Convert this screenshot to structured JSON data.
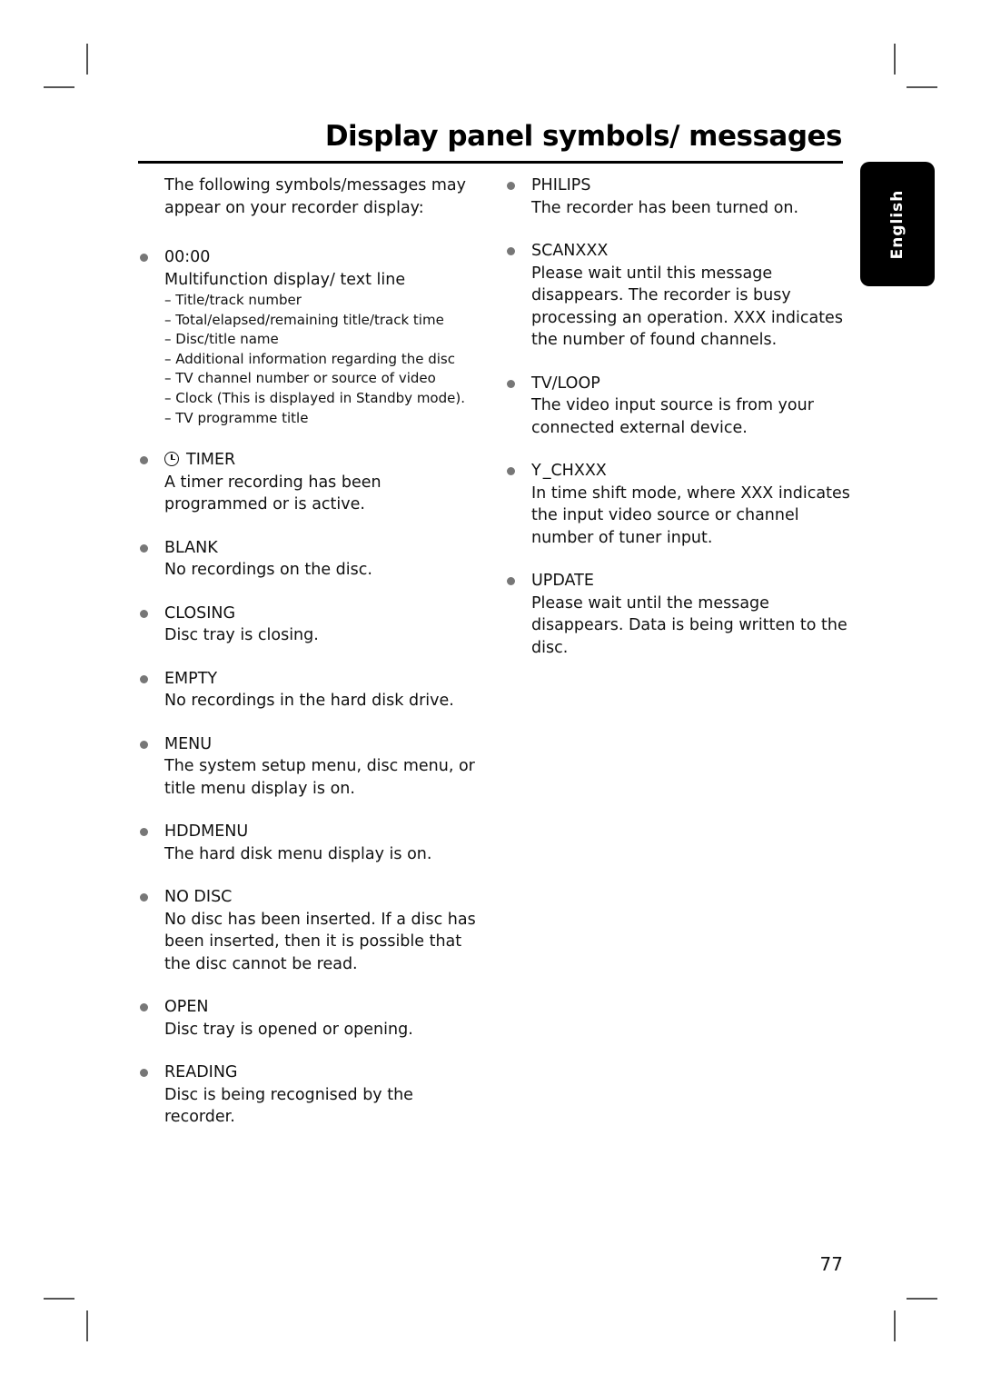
{
  "page": {
    "title": "Display panel symbols/ messages",
    "language_tab": "English",
    "page_number": "77"
  },
  "intro": "The following symbols/messages may appear on your recorder display:",
  "left_items": [
    {
      "head": "00:00",
      "desc": "Multifunction display/ text line",
      "sub": [
        "– Title/track number",
        "– Total/elapsed/remaining title/track time",
        "– Disc/title name",
        "– Additional information regarding the disc",
        "– TV channel number or source of video",
        "– Clock (This is displayed in Standby mode).",
        "– TV programme title"
      ]
    },
    {
      "icon": "clock-icon",
      "head": "TIMER",
      "desc": "A timer recording has been programmed or is active."
    },
    {
      "head": "BLANK",
      "desc": "No recordings on the disc."
    },
    {
      "head": "CLOSING",
      "desc": "Disc tray is closing."
    },
    {
      "head": "EMPTY",
      "desc": "No recordings in the hard disk drive."
    },
    {
      "head": "MENU",
      "desc": "The system setup menu, disc menu, or title menu display is on."
    },
    {
      "head": "HDDMENU",
      "desc": "The hard disk menu display is on."
    },
    {
      "head": "NO DISC",
      "desc": "No disc has been inserted. If a disc has been inserted, then it is possible that the disc cannot be read."
    },
    {
      "head": "OPEN",
      "desc": "Disc tray is opened or opening."
    },
    {
      "head": "READING",
      "desc": "Disc is being recognised by the recorder."
    }
  ],
  "right_items": [
    {
      "head": "PHILIPS",
      "desc": "The recorder has been turned on."
    },
    {
      "head": "SCANXXX",
      "desc": "Please wait until this message disappears. The recorder is busy processing an operation. XXX indicates the number of found channels."
    },
    {
      "head": "TV/LOOP",
      "desc": "The video input source is from your connected external device."
    },
    {
      "icon": "antenna-icon",
      "icon_glyph": "Y",
      "head": "_CHXXX",
      "desc": "In time shift mode, where XXX indicates the input video source or channel number of tuner input."
    },
    {
      "head": "UPDATE",
      "desc": "Please wait until the message disappears. Data is being written to the disc."
    }
  ]
}
